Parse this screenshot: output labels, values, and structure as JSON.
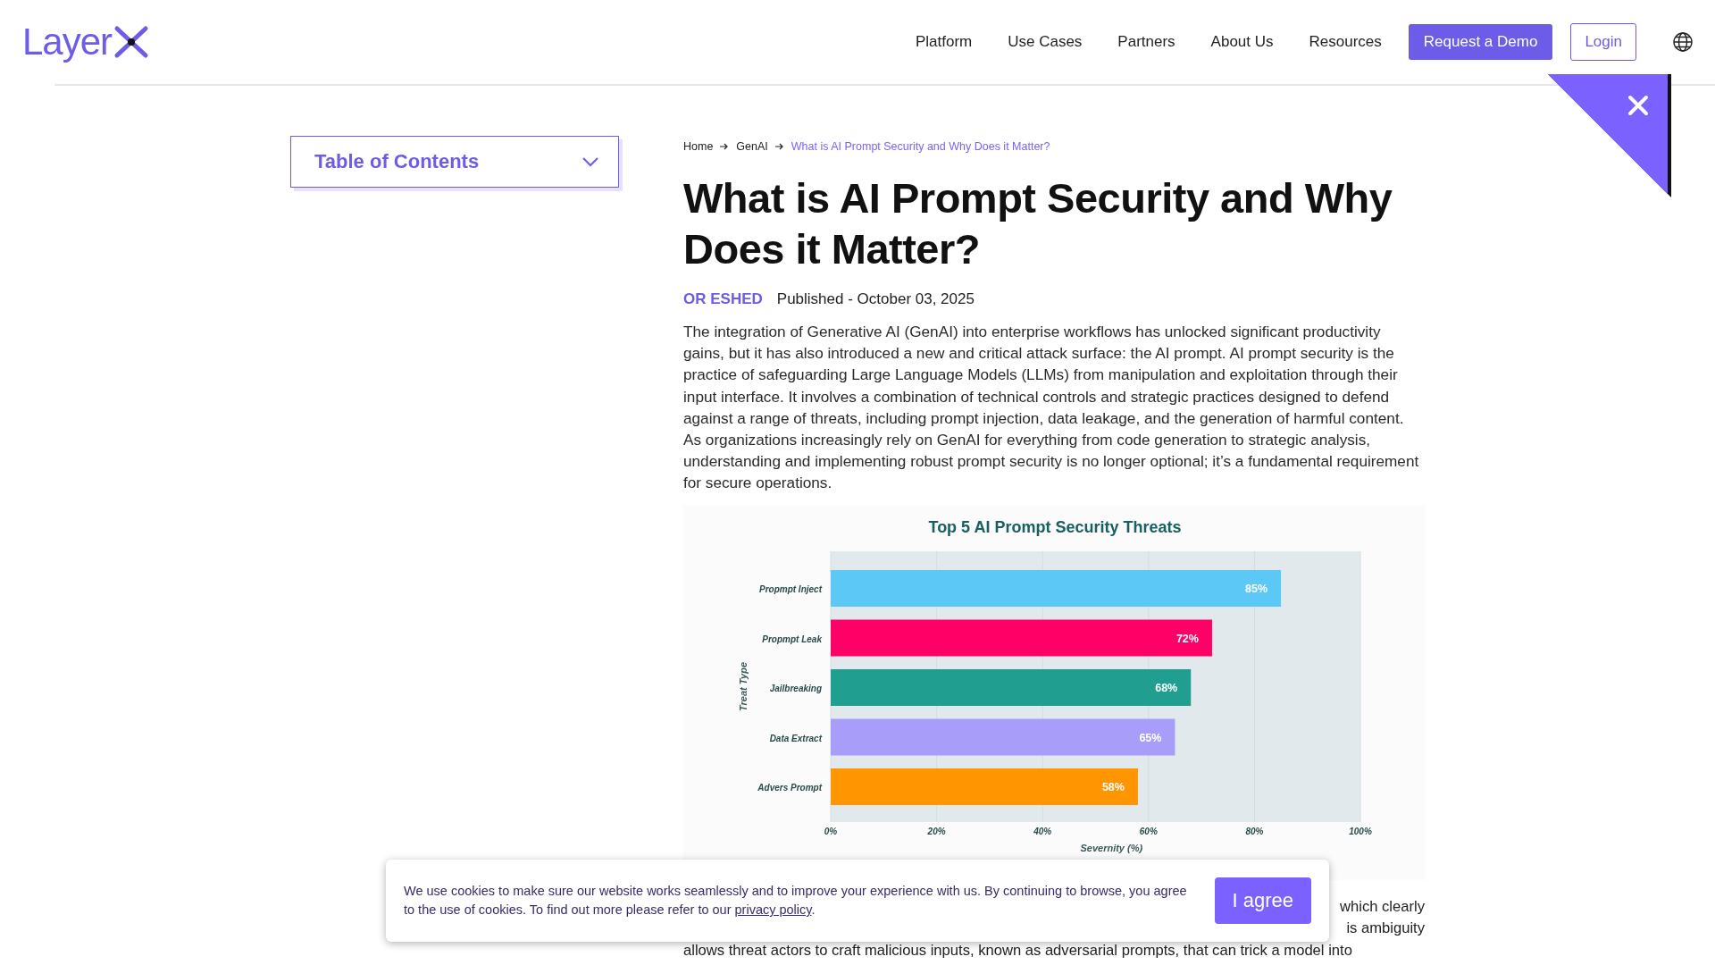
{
  "header": {
    "logo": "Layer",
    "nav": [
      "Platform",
      "Use Cases",
      "Partners",
      "About Us",
      "Resources"
    ],
    "demo_button": "Request a Demo",
    "login_button": "Login"
  },
  "toc": {
    "title": "Table of Contents",
    "expanded": false
  },
  "breadcrumb": [
    "Home",
    "GenAI",
    "What is AI Prompt Security and Why Does it Matter?"
  ],
  "article": {
    "title": "What is AI Prompt Security and Why Does it Matter?",
    "author": "OR ESHED",
    "published": "Published - October 03, 2025",
    "intro": "The integration of Generative AI (GenAI) into enterprise workflows has unlocked significant productivity gains, but it has also introduced a new and critical attack surface: the AI prompt. AI prompt security is the practice of safeguarding Large Language Models (LLMs) from manipulation and exploitation through their input interface. It involves a combination of technical controls and strategic practices designed to defend against a range of threats, including prompt injection, data leakage, and the generation of harmful content. As organizations increasingly rely on GenAI for everything from code generation to strategic analysis, understanding and implementing robust prompt security is no longer optional; it’s a fundamental requirement for secure operations.",
    "chart_data": {
      "type": "bar",
      "orientation": "horizontal",
      "title": "Top 5 AI Prompt Security Threats",
      "xlabel": "Severnity (%)",
      "ylabel": "Treat Type",
      "categories": [
        "Propmpt Inject",
        "Propmpt Leak",
        "Jailbreaking",
        "Data Extract",
        "Advers Prompt"
      ],
      "series": [
        {
          "values": [
            85,
            72,
            68,
            65,
            58
          ]
        }
      ],
      "grid": true,
      "colors": [
        "#5bc8f5",
        "#ff0066",
        "#209e8f",
        "#a89ef9",
        "#ff9500"
      ],
      "xlim": [
        0,
        100
      ],
      "xticks": [
        {
          "value": 0,
          "label": "0%"
        },
        {
          "value": 20,
          "label": "20%"
        },
        {
          "value": 40,
          "label": "40%"
        },
        {
          "value": 60,
          "label": "60%"
        },
        {
          "value": 80,
          "label": "80%"
        },
        {
          "value": 100,
          "label": "100%"
        }
      ],
      "value_labels": [
        "85%",
        "72%",
        "68%",
        "65%",
        "58%"
      ]
    },
    "fragments": [
      "which clearly",
      "is ambiguity",
      "allows threat actors to craft malicious inputs, known as adversarial prompts, that can trick a model into"
    ]
  },
  "cookie_banner": {
    "text_before": "We use cookies to make sure our website works seamlessly and to improve your experience with us. By continuing to browse, you agree to the use of cookies. To find out more please refer to our ",
    "link": "privacy policy",
    "text_after": ".",
    "button": "I agree"
  }
}
